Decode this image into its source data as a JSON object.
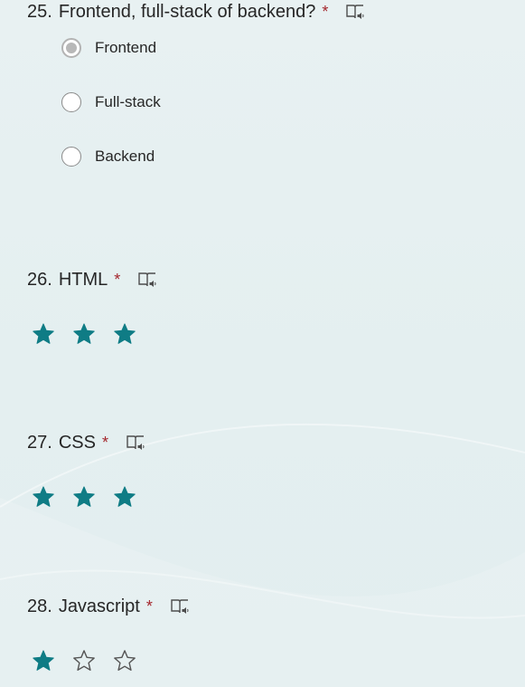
{
  "colors": {
    "accent": "#0f7c85",
    "required": "#a4262c",
    "text": "#262626"
  },
  "questions": [
    {
      "number": "25.",
      "title": "Frontend, full-stack of backend?",
      "required": "*",
      "reader_icon": "immersive-reader-icon",
      "type": "choice",
      "options": [
        {
          "label": "Frontend",
          "selected": true
        },
        {
          "label": "Full-stack",
          "selected": false
        },
        {
          "label": "Backend",
          "selected": false
        }
      ]
    },
    {
      "number": "26.",
      "title": "HTML",
      "required": "*",
      "reader_icon": "immersive-reader-icon",
      "type": "rating",
      "rating": 3,
      "max": 3
    },
    {
      "number": "27.",
      "title": "CSS",
      "required": "*",
      "reader_icon": "immersive-reader-icon",
      "type": "rating",
      "rating": 3,
      "max": 3
    },
    {
      "number": "28.",
      "title": "Javascript",
      "required": "*",
      "reader_icon": "immersive-reader-icon",
      "type": "rating",
      "rating": 1,
      "max": 3
    }
  ]
}
